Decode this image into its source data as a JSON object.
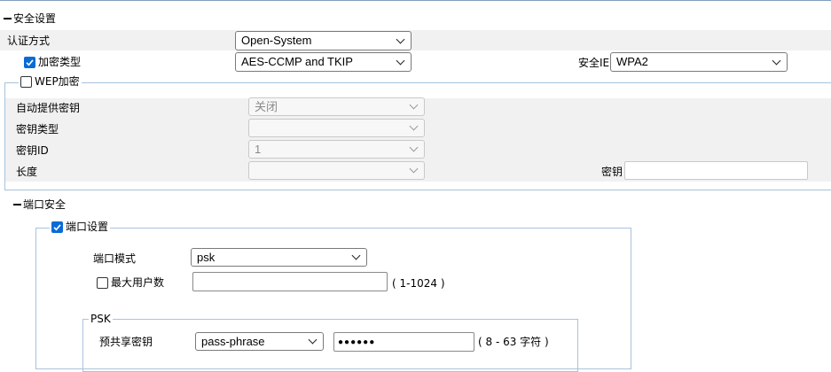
{
  "security_settings": {
    "title": "安全设置",
    "auth_method": {
      "label": "认证方式",
      "value": "Open-System"
    },
    "encryption_type": {
      "label": "加密类型",
      "checked": true,
      "value": "AES-CCMP and TKIP"
    },
    "security_ie": {
      "label": "安全IE",
      "value": "WPA2"
    },
    "wep": {
      "label": "WEP加密",
      "checked": false,
      "auto_key": {
        "label": "自动提供密钥",
        "value": "关闭"
      },
      "key_type": {
        "label": "密钥类型",
        "value": ""
      },
      "key_id": {
        "label": "密钥ID",
        "value": "1"
      },
      "length": {
        "label": "长度",
        "value": ""
      },
      "key": {
        "label": "密钥",
        "value": ""
      }
    }
  },
  "port_security": {
    "title": "端口安全",
    "port_settings": {
      "label": "端口设置",
      "checked": true,
      "port_mode": {
        "label": "端口模式",
        "value": "psk"
      },
      "max_users": {
        "label": "最大用户数",
        "checked": false,
        "value": "",
        "hint": "( 1-1024 )"
      },
      "psk": {
        "legend": "PSK",
        "preshared_key": {
          "label": "预共享密钥",
          "type_value": "pass-phrase",
          "value": "●●●●●●",
          "hint": "( 8 - 63 字符 )"
        }
      }
    }
  },
  "colors": {
    "checkbox_accent": "#0a6bd6",
    "band": "#f1f1f1",
    "fieldset_border": "#a8c3dc"
  }
}
